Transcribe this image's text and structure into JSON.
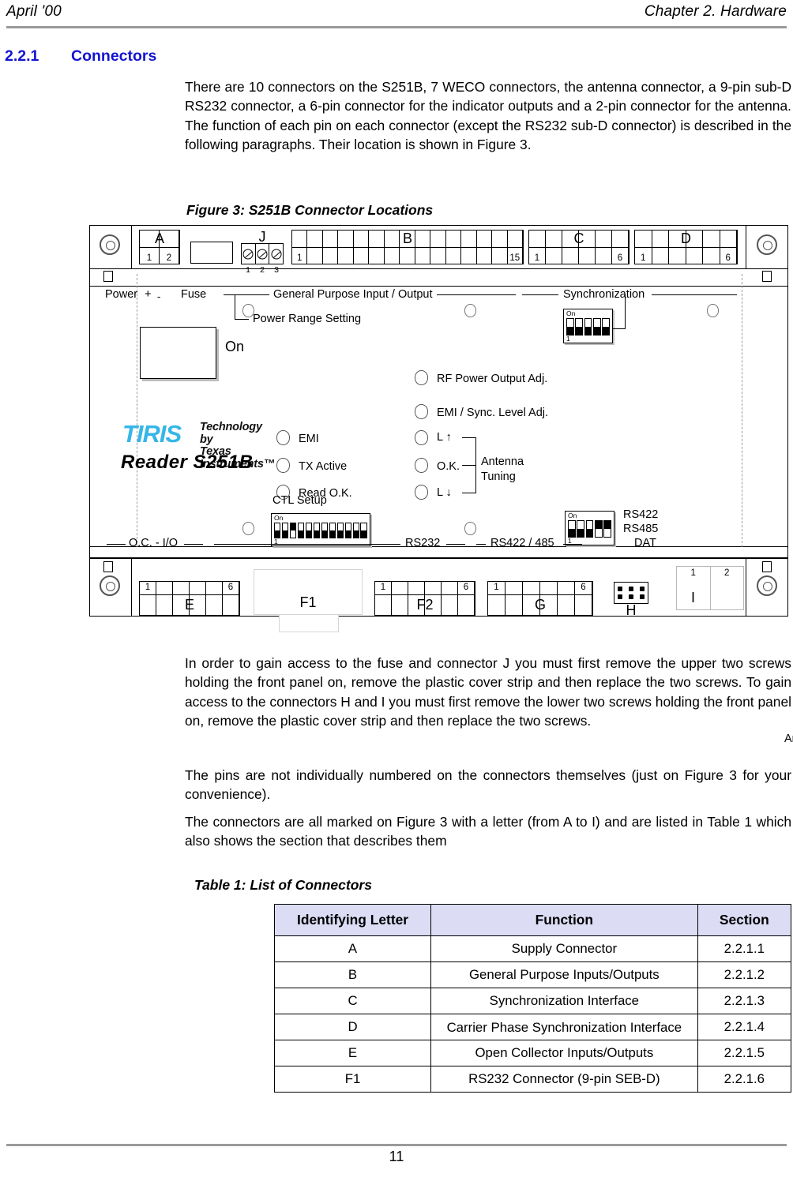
{
  "header": {
    "left": "April '00",
    "right": "Chapter 2. Hardware"
  },
  "section": {
    "number": "2.2.1",
    "title": "Connectors"
  },
  "paragraphs": {
    "intro": "There are 10 connectors on the S251B, 7 WECO connectors, the antenna connector, a 9-pin sub-D RS232 connector, a 6-pin connector for the indicator outputs and a 2-pin connector for the antenna. The function of each pin on each connector (except the RS232 sub-D connector) is described in the following paragraphs. Their location is shown in Figure 3.",
    "access": "In order to gain access to the fuse and connector J you must first remove the upper two screws holding the front panel on, remove the plastic cover strip and then replace the two screws. To gain access to the connectors H and I you must first remove the lower two screws holding the front panel on, remove the plastic cover strip and then replace the two screws.",
    "pins": "The pins are not individually numbered on the connectors themselves (just on Figure 3 for your convenience).",
    "marked": "The connectors are all marked on Figure 3 with a letter (from A to I) and are listed in Table 1 which also shows the section that describes them"
  },
  "figure": {
    "caption": "Figure 3: S251B Connector Locations",
    "connectors": {
      "a": {
        "letter": "A",
        "pin_first": "1",
        "pin_last": "2",
        "cells": 2
      },
      "j": {
        "letter": "J",
        "pins": [
          "1",
          "2",
          "3"
        ],
        "cells": 3
      },
      "b": {
        "letter": "B",
        "pin_first": "1",
        "pin_last": "15",
        "cells": 15
      },
      "c": {
        "letter": "C",
        "pin_first": "1",
        "pin_last": "6",
        "cells": 6
      },
      "d": {
        "letter": "D",
        "pin_first": "1",
        "pin_last": "6",
        "cells": 6
      },
      "e": {
        "letter": "E",
        "pin_first": "1",
        "pin_last": "6",
        "cells": 6
      },
      "f1": {
        "letter": "F1"
      },
      "f2": {
        "letter": "F2",
        "pin_first": "1",
        "pin_last": "6",
        "cells": 6
      },
      "g": {
        "letter": "G",
        "pin_first": "1",
        "pin_last": "6",
        "cells": 6
      },
      "h": {
        "letter": "H",
        "rows": 2,
        "cols": 3
      },
      "i": {
        "letter": "I",
        "pin_first": "1",
        "pin_last": "2",
        "cells": 2
      }
    },
    "labels": {
      "power": "Power",
      "power_plus": "+",
      "power_minus": "-",
      "fuse": "Fuse",
      "gpio": "General Purpose Input / Output",
      "power_range": "Power Range Setting",
      "synchronization": "Synchronization",
      "on_fuse": "On",
      "rf_power_adj": "RF Power Output Adj.",
      "emi_sync_level_adj": "EMI / Sync. Level Adj.",
      "emi": "EMI",
      "tx_active": "TX Active",
      "read_ok": "Read O.K.",
      "l_up": "L ↑",
      "ok": "O.K.",
      "l_down": "L ↓",
      "antenna_tuning_1": "Antenna",
      "antenna_tuning_2": "Tuning",
      "ctl_setup": "CTL Setup",
      "oc_io": "O.C. - I/O",
      "rs232": "RS232",
      "rs422_485": "RS422 / 485",
      "rs422": "RS422",
      "rs485": "RS485",
      "dat": "DAT",
      "antenna": "Antenna"
    },
    "dip_switches": {
      "sync": {
        "on_label": "On",
        "start_label": "1",
        "count": 5,
        "states": [
          "off",
          "off",
          "off",
          "off",
          "off"
        ]
      },
      "ctl_setup": {
        "on_label": "On",
        "start_label": "1",
        "count": 12,
        "states": [
          "off",
          "off",
          "on",
          "off",
          "off",
          "off",
          "off",
          "off",
          "off",
          "off",
          "off",
          "off"
        ]
      },
      "rs422_485": {
        "on_label": "On",
        "start_label": "1",
        "count": 5,
        "states": [
          "off",
          "off",
          "off",
          "on",
          "on"
        ]
      }
    },
    "brand": {
      "logo_word": "TIRIS",
      "tagline_line1": "Technology by",
      "tagline_line2": "Texas Instruments™",
      "model": "Reader  S251B",
      "logo_color": "#36b6e8"
    }
  },
  "table": {
    "caption": "Table 1: List of Connectors",
    "headers": [
      "Identifying Letter",
      "Function",
      "Section"
    ],
    "header_bg": "#dcdcf5",
    "rows": [
      {
        "letter": "A",
        "function": "Supply Connector",
        "section": "2.2.1.1"
      },
      {
        "letter": "B",
        "function": "General Purpose Inputs/Outputs",
        "section": "2.2.1.2"
      },
      {
        "letter": "C",
        "function": "Synchronization Interface",
        "section": "2.2.1.3"
      },
      {
        "letter": "D",
        "function": "Carrier Phase Synchronization Interface",
        "section": "2.2.1.4"
      },
      {
        "letter": "E",
        "function": "Open Collector Inputs/Outputs",
        "section": "2.2.1.5"
      },
      {
        "letter": "F1",
        "function": "RS232 Connector (9-pin SEB-D)",
        "section": "2.2.1.6"
      }
    ]
  },
  "footer": {
    "page_number": "11"
  }
}
